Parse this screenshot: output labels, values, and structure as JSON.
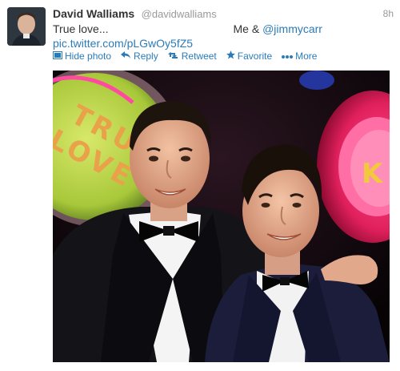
{
  "tweet": {
    "name": "David Walliams",
    "handle": "@davidwalliams",
    "time": "8h",
    "text_start": "True love...",
    "text_me": "Me & ",
    "mention": "@jimmycarr",
    "pic_link": "pic.twitter.com/pLGwOy5fZ5"
  },
  "actions": {
    "hide_photo": "Hide photo",
    "reply": "Reply",
    "retweet": "Retweet",
    "favorite": "Favorite",
    "more": "More"
  },
  "photo": {
    "sign_left": "TRUE LOVE",
    "sign_right": "K"
  },
  "colors": {
    "link": "#2b7bb9",
    "name": "#333333",
    "muted": "#999999"
  }
}
